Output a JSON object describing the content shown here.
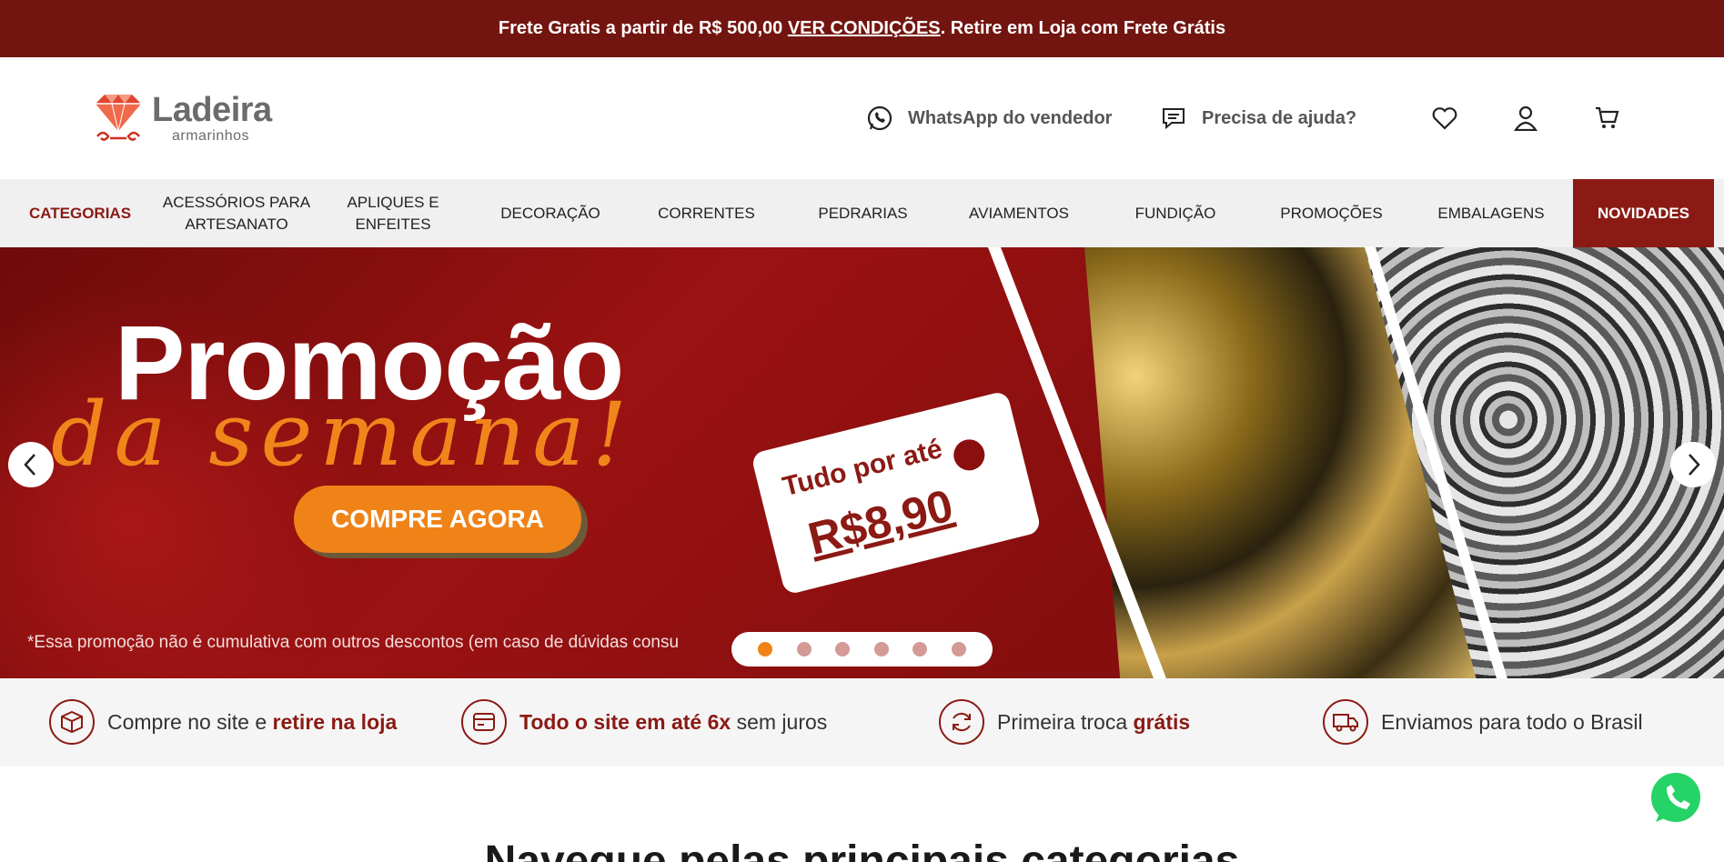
{
  "topbar": {
    "text_before": "Frete Gratis a partir de R$ 500,00 ",
    "link": "VER CONDIÇÕES",
    "text_after": ". Retire em Loja com Frete Grátis"
  },
  "header": {
    "logo_name": "Ladeira",
    "logo_sub": "armarinhos",
    "whatsapp_label": "WhatsApp do vendedor",
    "help_label": "Precisa de ajuda?"
  },
  "nav": {
    "items": [
      {
        "label": "CATEGORIAS"
      },
      {
        "label": "ACESSÓRIOS PARA ARTESANATO"
      },
      {
        "label": "APLIQUES E ENFEITES"
      },
      {
        "label": "DECORAÇÃO"
      },
      {
        "label": "CORRENTES"
      },
      {
        "label": "PEDRARIAS"
      },
      {
        "label": "AVIAMENTOS"
      },
      {
        "label": "FUNDIÇÃO"
      },
      {
        "label": "PROMOÇÕES"
      },
      {
        "label": "EMBALAGENS"
      },
      {
        "label": "NOVIDADES"
      }
    ]
  },
  "banner": {
    "title": "Promoção",
    "script": "da semana!",
    "cta": "COMPRE AGORA",
    "tag_line1": "Tudo por até",
    "tag_price": "R$8,90",
    "disclaimer": "*Essa promoção não é cumulativa com outros descontos (em caso de dúvidas consu",
    "slides_total": 6,
    "active_slide": 1
  },
  "benefits": [
    {
      "pre": "Compre no site e ",
      "bold": "retire na loja",
      "post": ""
    },
    {
      "pre": "",
      "bold": "Todo o site em até 6x",
      "post": " sem juros"
    },
    {
      "pre": "Primeira troca ",
      "bold": "grátis",
      "post": ""
    },
    {
      "pre": "Enviamos para todo o Brasil",
      "bold": "",
      "post": ""
    }
  ],
  "section": {
    "title": "Navegue pelas principais categorias"
  },
  "colors": {
    "brand": "#8b1a14",
    "topbar": "#721510",
    "accent": "#ef8317",
    "whatsapp": "#25d366"
  },
  "icons": [
    "whatsapp-icon",
    "chat-icon",
    "heart-icon",
    "user-icon",
    "cart-icon",
    "box-icon",
    "card-icon",
    "refresh-icon",
    "truck-icon"
  ]
}
